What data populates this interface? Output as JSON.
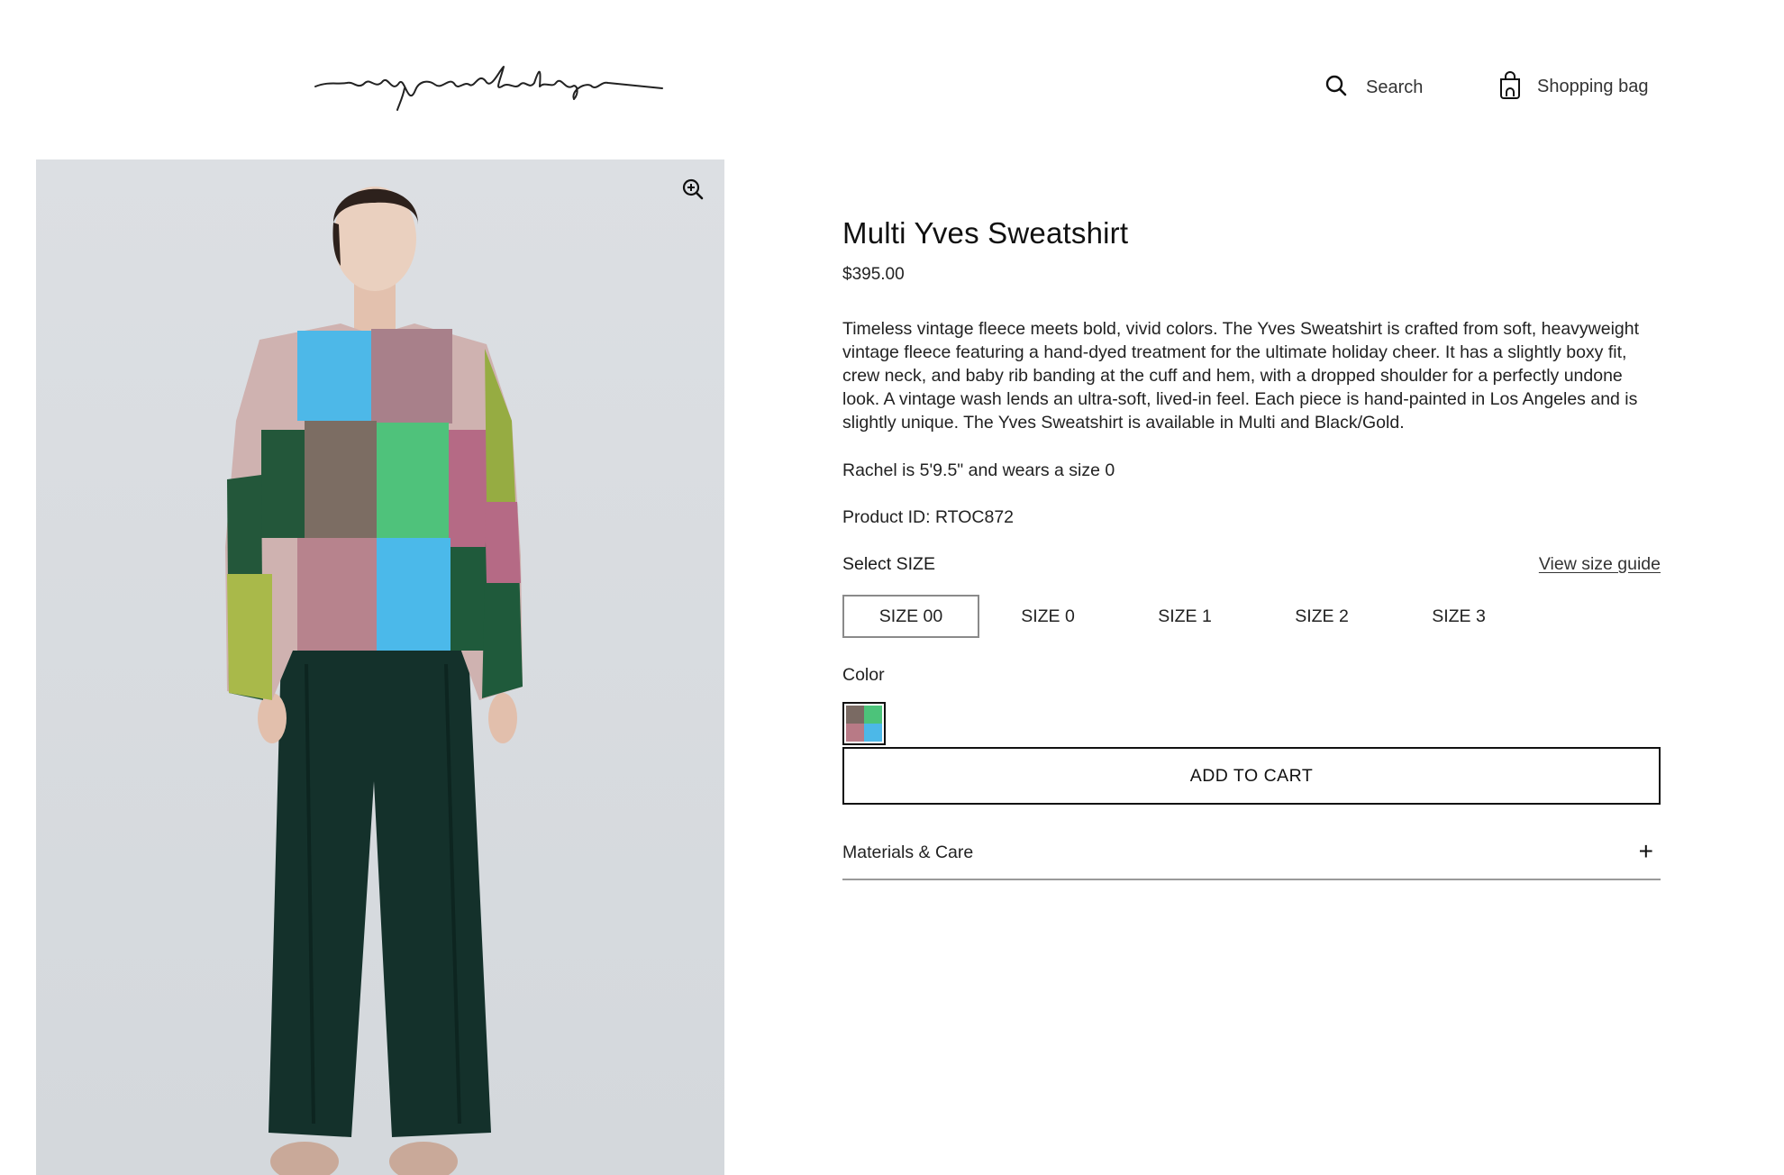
{
  "header": {
    "logo_text": "raquel allegra",
    "search_label": "Search",
    "bag_label": "Shopping bag",
    "search_icon": "search-icon",
    "bag_icon": "shopping-bag-icon"
  },
  "gallery": {
    "zoom_icon": "zoom-in-icon"
  },
  "product": {
    "title": "Multi Yves Sweatshirt",
    "price": "$395.00",
    "description": "Timeless vintage fleece meets bold, vivid colors. The Yves Sweatshirt is crafted from soft, heavyweight vintage fleece featuring a hand-dyed treatment for the ultimate holiday cheer. It has a slightly boxy fit, crew neck, and baby rib banding at the cuff and hem, with a dropped shoulder for a perfectly undone look. A vintage wash lends an ultra-soft, lived-in feel. Each piece is hand-painted in Los Angeles and is slightly unique. The Yves Sweatshirt is available in Multi and Black/Gold.",
    "fit_note": "Rachel is 5'9.5\" and wears a size 0",
    "product_id": "Product ID: RTOC872"
  },
  "size": {
    "label": "Select SIZE",
    "guide_link": "View size guide",
    "options": [
      "SIZE 00",
      "SIZE 0",
      "SIZE 1",
      "SIZE 2",
      "SIZE 3"
    ],
    "selected": "SIZE 00"
  },
  "color": {
    "label": "Color",
    "swatch_colors": [
      "#7a6a63",
      "#4cc37a",
      "#b87a86",
      "#4cb8e8"
    ]
  },
  "actions": {
    "add_to_cart": "ADD TO CART"
  },
  "accordion": {
    "materials_label": "Materials & Care",
    "toggle": "+"
  }
}
